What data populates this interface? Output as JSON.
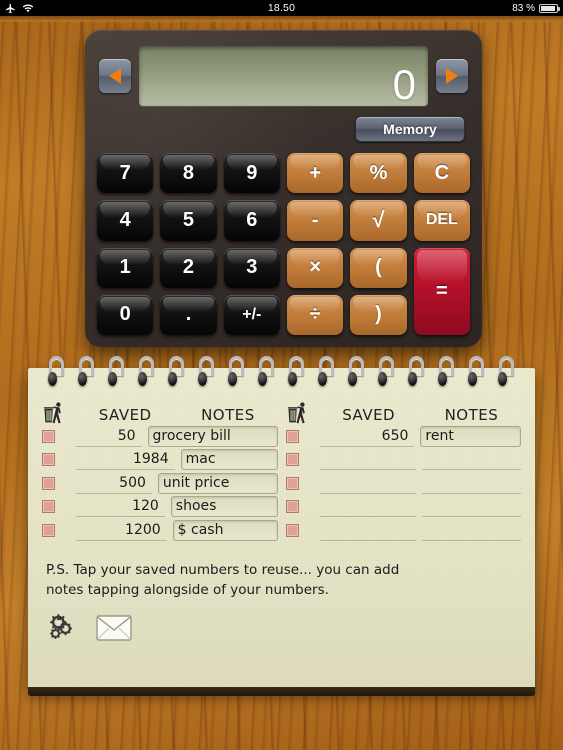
{
  "status_bar": {
    "airplane_icon": "airplane-icon",
    "wifi_icon": "wifi-icon",
    "time": "18.50",
    "battery_percent": "83 %",
    "battery_icon": "battery-icon"
  },
  "calculator": {
    "display_value": "0",
    "left_arrow_icon": "left-arrow-icon",
    "right_arrow_icon": "right-arrow-icon",
    "memory_label": "Memory",
    "keys": [
      {
        "label": "7",
        "type": "num"
      },
      {
        "label": "8",
        "type": "num"
      },
      {
        "label": "9",
        "type": "num"
      },
      {
        "label": "+",
        "type": "op"
      },
      {
        "label": "%",
        "type": "op"
      },
      {
        "label": "C",
        "type": "op"
      },
      {
        "label": "4",
        "type": "num"
      },
      {
        "label": "5",
        "type": "num"
      },
      {
        "label": "6",
        "type": "num"
      },
      {
        "label": "-",
        "type": "op"
      },
      {
        "label": "√",
        "type": "op"
      },
      {
        "label": "DEL",
        "type": "op"
      },
      {
        "label": "1",
        "type": "num"
      },
      {
        "label": "2",
        "type": "num"
      },
      {
        "label": "3",
        "type": "num"
      },
      {
        "label": "×",
        "type": "op"
      },
      {
        "label": "(",
        "type": "op"
      },
      {
        "label": "=",
        "type": "eq"
      },
      {
        "label": "0",
        "type": "num"
      },
      {
        "label": ".",
        "type": "num"
      },
      {
        "label": "+/-",
        "type": "num"
      },
      {
        "label": "÷",
        "type": "op"
      },
      {
        "label": ")",
        "type": "op"
      }
    ]
  },
  "notepad": {
    "trash_icon": "trash-icon",
    "headers": {
      "saved": "SAVED",
      "notes": "NOTES"
    },
    "columns": [
      {
        "rows": [
          {
            "saved": "50",
            "note": "grocery bill"
          },
          {
            "saved": "1984",
            "note": "mac"
          },
          {
            "saved": "500",
            "note": "unit price"
          },
          {
            "saved": "120",
            "note": "shoes"
          },
          {
            "saved": "1200",
            "note": "$ cash"
          }
        ]
      },
      {
        "rows": [
          {
            "saved": "650",
            "note": "rent"
          },
          {
            "saved": "",
            "note": ""
          },
          {
            "saved": "",
            "note": ""
          },
          {
            "saved": "",
            "note": ""
          },
          {
            "saved": "",
            "note": ""
          }
        ]
      }
    ],
    "ps_line1": "P.S. Tap your saved numbers to reuse... you can add",
    "ps_line2": "notes tapping alongside of your numbers.",
    "settings_icon": "gears-icon",
    "mail_icon": "envelope-icon"
  },
  "colors": {
    "wood": "#b97420",
    "calc_body": "#3b322e",
    "lcd_green": "#8d9577",
    "operator_orange": "#c37f3c",
    "equals_red": "#b4112a",
    "paper": "#e8e7cb",
    "checkbox_pink": "#dfa193",
    "arrow_orange": "#f07d10"
  }
}
